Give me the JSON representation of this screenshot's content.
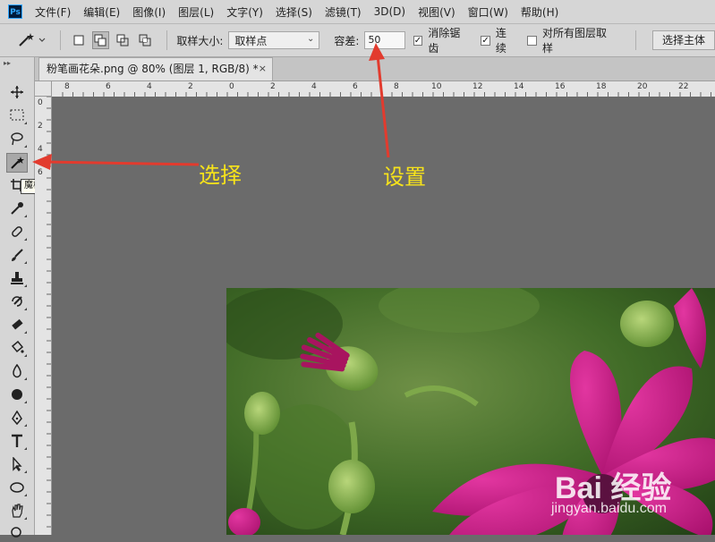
{
  "app": {
    "logo_text": "Ps"
  },
  "menubar": {
    "items": [
      "文件(F)",
      "编辑(E)",
      "图像(I)",
      "图层(L)",
      "文字(Y)",
      "选择(S)",
      "滤镜(T)",
      "3D(D)",
      "视图(V)",
      "窗口(W)",
      "帮助(H)"
    ]
  },
  "options": {
    "sample_size_label": "取样大小:",
    "sample_size_value": "取样点",
    "tolerance_label": "容差:",
    "tolerance_value": "50",
    "antialias_label": "消除锯齿",
    "contiguous_label": "连续",
    "all_layers_label": "对所有图层取样",
    "select_subject_button": "选择主体"
  },
  "document": {
    "tab_title": "粉笔画花朵.png @ 80% (图层 1, RGB/8) *",
    "close_glyph": "×"
  },
  "rulers": {
    "horizontal_labels": [
      "8",
      "6",
      "4",
      "2",
      "0",
      "2",
      "4",
      "6",
      "8",
      "10",
      "12",
      "14",
      "16",
      "18",
      "20",
      "22"
    ],
    "vertical_labels": [
      "0",
      "2",
      "4",
      "6"
    ]
  },
  "toolbar": {
    "active_tool": "magic-wand",
    "tooltip": "魔棒工具 (W)"
  },
  "annotations": {
    "select_label": "选择",
    "settings_label": "设置",
    "arrow_color": "#e23b2e",
    "text_color": "#f7e31a"
  },
  "watermark": {
    "main": "Bai 经验",
    "sub": "jingyan.baidu.com"
  },
  "colors": {
    "ui_gray": "#d6d6d6",
    "workspace": "#6b6b6b",
    "flower_magenta": "#c2137d",
    "foliage": "#3f6a26"
  }
}
